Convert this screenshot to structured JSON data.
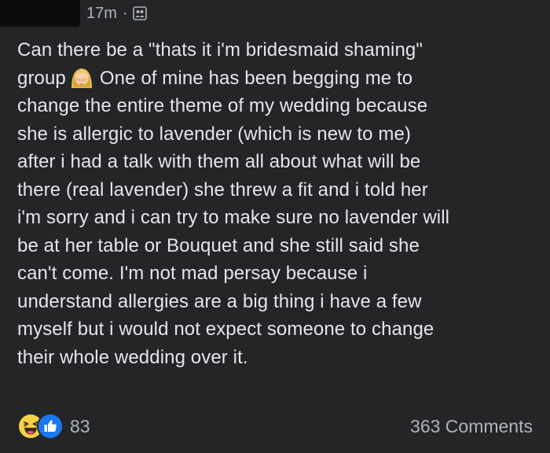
{
  "post": {
    "timestamp": "17m",
    "separator": "·",
    "audience_icon": "friends-audience-icon",
    "lines": [
      "Can there be a \"thats it i'm bridesmaid shaming\"",
      "group",
      "One of mine has been begging me to",
      "change the entire theme of my wedding because",
      "she is allergic to lavender (which is new to me)",
      "after i had a talk with them all about what will be",
      "there (real lavender) she threw a fit and i told her",
      "i'm sorry and i can try to make sure no lavender will",
      "be at her table or Bouquet and she still said she",
      "can't come. I'm not mad persay because i",
      "understand allergies are a big thing i have a few",
      "myself but i would not expect someone to change",
      "their whole wedding over it."
    ],
    "inline_emoji": "face-palm-emoji"
  },
  "footer": {
    "reaction_icons": [
      "haha-reaction-icon",
      "like-reaction-icon"
    ],
    "reaction_count": "83",
    "comments_label": "363 Comments"
  },
  "colors": {
    "background": "#232527",
    "text": "#e4e6eb",
    "muted": "#b0b3b8",
    "like_blue": "#1877f2",
    "haha_yellow": "#f7d046"
  }
}
